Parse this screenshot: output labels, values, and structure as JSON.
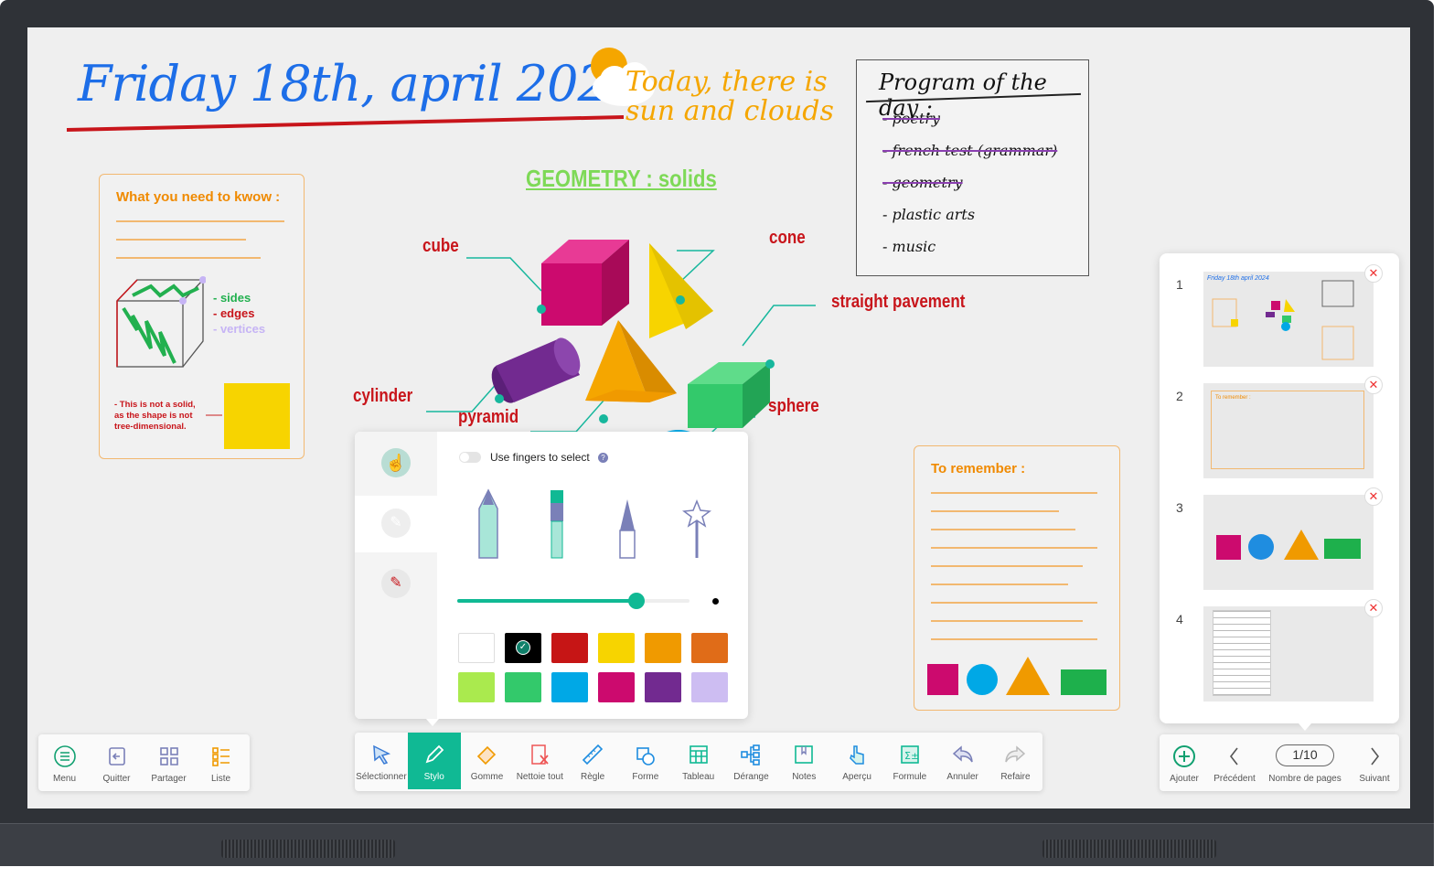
{
  "board": {
    "date_title": "Friday 18th, april 2024",
    "weather": "Today, there is sun and clouds",
    "geometry_title": "GEOMETRY : solids",
    "program": {
      "title": "Program of the day :",
      "items": [
        {
          "text": "- poetry",
          "done": true
        },
        {
          "text": "- french test (grammar)",
          "done": true
        },
        {
          "text": "- geometry",
          "done": true
        },
        {
          "text": "- plastic arts",
          "done": false
        },
        {
          "text": "- music",
          "done": false
        }
      ]
    },
    "know_card": {
      "title": "What you need to kwow :",
      "legend": [
        "- sides",
        "- edges",
        "- vertices"
      ],
      "note": "- This is not a solid, as the shape is not tree-dimensional."
    },
    "shape_labels": {
      "cube": "cube",
      "cone": "cone",
      "cylinder": "cylinder",
      "pyramid": "pyramid",
      "prism": "straight pavement",
      "sphere": "sphere"
    },
    "remember_card": {
      "title": "To remember :"
    }
  },
  "pen_panel": {
    "toggle_label": "Use fingers to select",
    "toggle_on": false,
    "help_icon": "question-circle-icon",
    "pen_types": [
      "pencil",
      "marker",
      "brush",
      "magic-wand"
    ],
    "selected_pen": "marker",
    "thickness": 0.77,
    "colors": [
      "#ffffff",
      "#000000",
      "#c61515",
      "#f7d400",
      "#f09a00",
      "#e06c18",
      "#aaea4e",
      "#33c96b",
      "#00a8e6",
      "#cc0a6e",
      "#722a90",
      "#cdbdf2"
    ],
    "selected_color": "#000000"
  },
  "left_toolbar": [
    {
      "label": "Menu",
      "icon": "menu-icon"
    },
    {
      "label": "Quitter",
      "icon": "exit-icon"
    },
    {
      "label": "Partager",
      "icon": "qr-share-icon"
    },
    {
      "label": "Liste",
      "icon": "list-icon"
    }
  ],
  "main_toolbar": [
    {
      "label": "Sélectionner",
      "icon": "cursor-icon"
    },
    {
      "label": "Stylo",
      "icon": "pen-icon",
      "active": true
    },
    {
      "label": "Gomme",
      "icon": "eraser-icon"
    },
    {
      "label": "Nettoie tout",
      "icon": "clear-all-icon"
    },
    {
      "label": "Règle",
      "icon": "ruler-icon"
    },
    {
      "label": "Forme",
      "icon": "shapes-icon"
    },
    {
      "label": "Tableau",
      "icon": "table-icon"
    },
    {
      "label": "Dérange",
      "icon": "mindmap-icon"
    },
    {
      "label": "Notes",
      "icon": "notes-icon"
    },
    {
      "label": "Aperçu",
      "icon": "touch-icon"
    },
    {
      "label": "Formule",
      "icon": "formula-icon"
    },
    {
      "label": "Annuler",
      "icon": "undo-icon"
    },
    {
      "label": "Refaire",
      "icon": "redo-icon"
    }
  ],
  "pages": {
    "thumbnails": [
      "1",
      "2",
      "3",
      "4"
    ],
    "add_label": "Ajouter",
    "prev_label": "Précédent",
    "counter": "1/10",
    "counter_label": "Nombre de pages",
    "next_label": "Suivant"
  },
  "accent": "#10b994"
}
